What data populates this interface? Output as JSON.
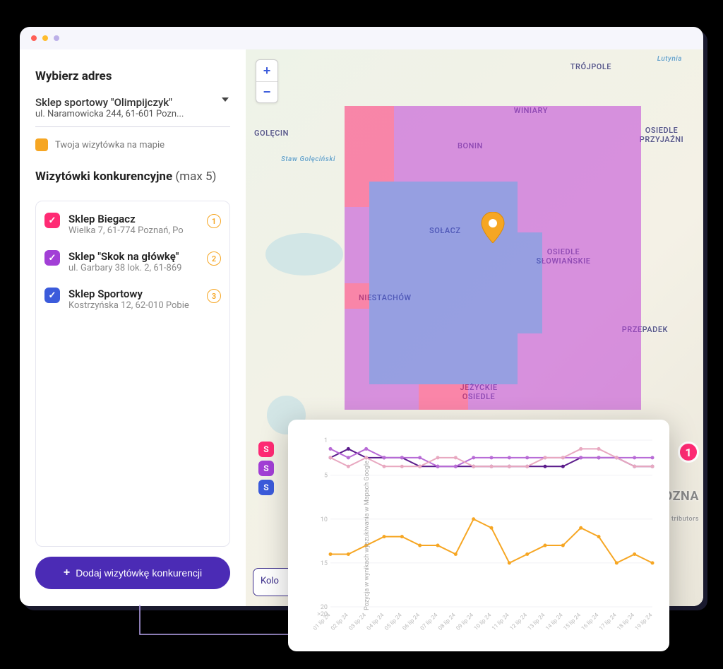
{
  "sidebar": {
    "select_label": "Wybierz adres",
    "selected_name": "Sklep sportowy \"Olimpijczyk\"",
    "selected_addr": "ul. Naramowicka 244, 61-601 Pozn...",
    "own_legend": "Twoja wizytówka na mapie",
    "competitors_label": "Wizytówki konkurencyjne",
    "competitors_limit": "(max 5)",
    "competitors": [
      {
        "name": "Sklep Biegacz",
        "addr": "Wielka 7, 61-774 Poznań, Po",
        "rank": "1",
        "color": "pink"
      },
      {
        "name": "Sklep \"Skok na główkę\"",
        "addr": "ul. Garbary 38 lok. 2, 61-869",
        "rank": "2",
        "color": "purple"
      },
      {
        "name": "Sklep Sportowy",
        "addr": "Kostrzyńska 12, 62-010 Pobie",
        "rank": "3",
        "color": "blue"
      }
    ],
    "add_button": "Dodaj wizytówkę konkurencji"
  },
  "map": {
    "zoom_in": "+",
    "zoom_out": "−",
    "labels": {
      "trojpole": "TRÓJPOLE",
      "winiary": "WINIARY",
      "golecin": "GOLĘCIN",
      "osiedle_przyjazni": "OSIEDLE PRZYJAŹNI",
      "bonin": "BONIN",
      "solacz": "SOŁACZ",
      "osiedle_slowianskie": "OSIEDLE SŁOWIAŃSKIE",
      "niestachow": "NIESTACHÓW",
      "przepadek": "PRZEPADEK",
      "jezyckie_osiedle": "JEŻYCKIE OSIEDLE",
      "oznan": "OZNA",
      "staw": "Staw Golęciński",
      "lutynia": "Lutynia",
      "contributors": "tributors"
    },
    "poi_letter": "S",
    "big_badge": "1",
    "kolor": "Kolo"
  },
  "chart_data": {
    "type": "line",
    "title": "",
    "ylabel": "Pozycja w wynikach wyszukiwania w Mapach Google",
    "ylim": [
      20,
      1
    ],
    "yticks": [
      1,
      5,
      10,
      15,
      20,
      ">20"
    ],
    "categories": [
      "01 lip 24",
      "02 lip 24",
      "03 lip 24",
      "04 lip 24",
      "05 lip 24",
      "06 lip 24",
      "07 lip 24",
      "08 lip 24",
      "09 lip 24",
      "10 lip 24",
      "11 lip 24",
      "12 lip 24",
      "13 lip 24",
      "14 lip 24",
      "15 lip 24",
      "16 lip 24",
      "17 lip 24",
      "18 lip 24",
      "19 lip 24"
    ],
    "series": [
      {
        "name": "purple-dark",
        "color": "#5a1b8b",
        "values": [
          3,
          2,
          3,
          3,
          3,
          4,
          4,
          4,
          4,
          4,
          4,
          4,
          4,
          4,
          3,
          3,
          3,
          4,
          4
        ]
      },
      {
        "name": "purple-light",
        "color": "#b86bd6",
        "values": [
          2,
          3,
          2,
          3,
          3,
          3,
          4,
          4,
          3,
          3,
          3,
          3,
          3,
          3,
          3,
          3,
          3,
          3,
          3
        ]
      },
      {
        "name": "pink",
        "color": "#e8a8c0",
        "values": [
          3,
          4,
          3,
          4,
          4,
          4,
          3,
          3,
          4,
          4,
          4,
          4,
          3,
          3,
          2,
          2,
          3,
          4,
          4
        ]
      },
      {
        "name": "orange",
        "color": "#f6a623",
        "values": [
          14,
          14,
          13,
          12,
          12,
          13,
          13,
          14,
          10,
          11,
          15,
          14,
          13,
          13,
          11,
          12,
          15,
          14,
          15
        ]
      }
    ]
  }
}
